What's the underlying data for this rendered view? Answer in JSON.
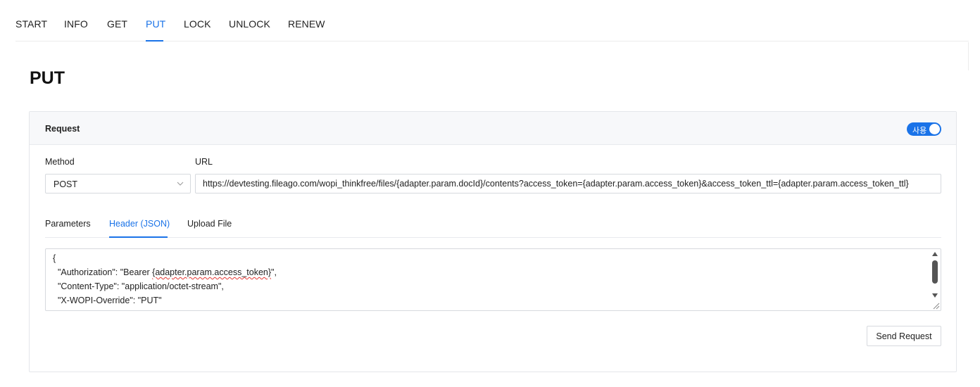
{
  "nav": {
    "tabs": [
      {
        "label": "START"
      },
      {
        "label": "INFO"
      },
      {
        "label": "GET"
      },
      {
        "label": "PUT"
      },
      {
        "label": "LOCK"
      },
      {
        "label": "UNLOCK"
      },
      {
        "label": "RENEW"
      }
    ],
    "active_tab": "PUT"
  },
  "page": {
    "title": "PUT"
  },
  "request": {
    "title": "Request",
    "toggle": {
      "label": "사용",
      "on": true
    },
    "method_label": "Method",
    "method_value": "POST",
    "url_label": "URL",
    "url_value": "https://devtesting.fileago.com/wopi_thinkfree/files/{adapter.param.docId}/contents?access_token={adapter.param.access_token}&access_token_ttl={adapter.param.access_token_ttl}",
    "tabs": [
      {
        "label": "Parameters"
      },
      {
        "label": "Header (JSON)"
      },
      {
        "label": "Upload File"
      }
    ],
    "active_tab": "Header (JSON)",
    "header_json": {
      "line1": "{",
      "line2_prefix": "  \"Authorization\": \"Bearer ",
      "line2_token": "{adapter.param.access_token}",
      "line2_suffix": "\",",
      "line3": "  \"Content-Type\": \"application/octet-stream\",",
      "line4": "  \"X-WOPI-Override\": \"PUT\""
    },
    "send_label": "Send Request"
  },
  "colors": {
    "accent": "#1a73e8",
    "border": "#d6d9de",
    "header_bg": "#f7f8fa"
  },
  "icons": {
    "select_arrow": "chevron-down-icon",
    "resize": "resize-grip-icon"
  }
}
